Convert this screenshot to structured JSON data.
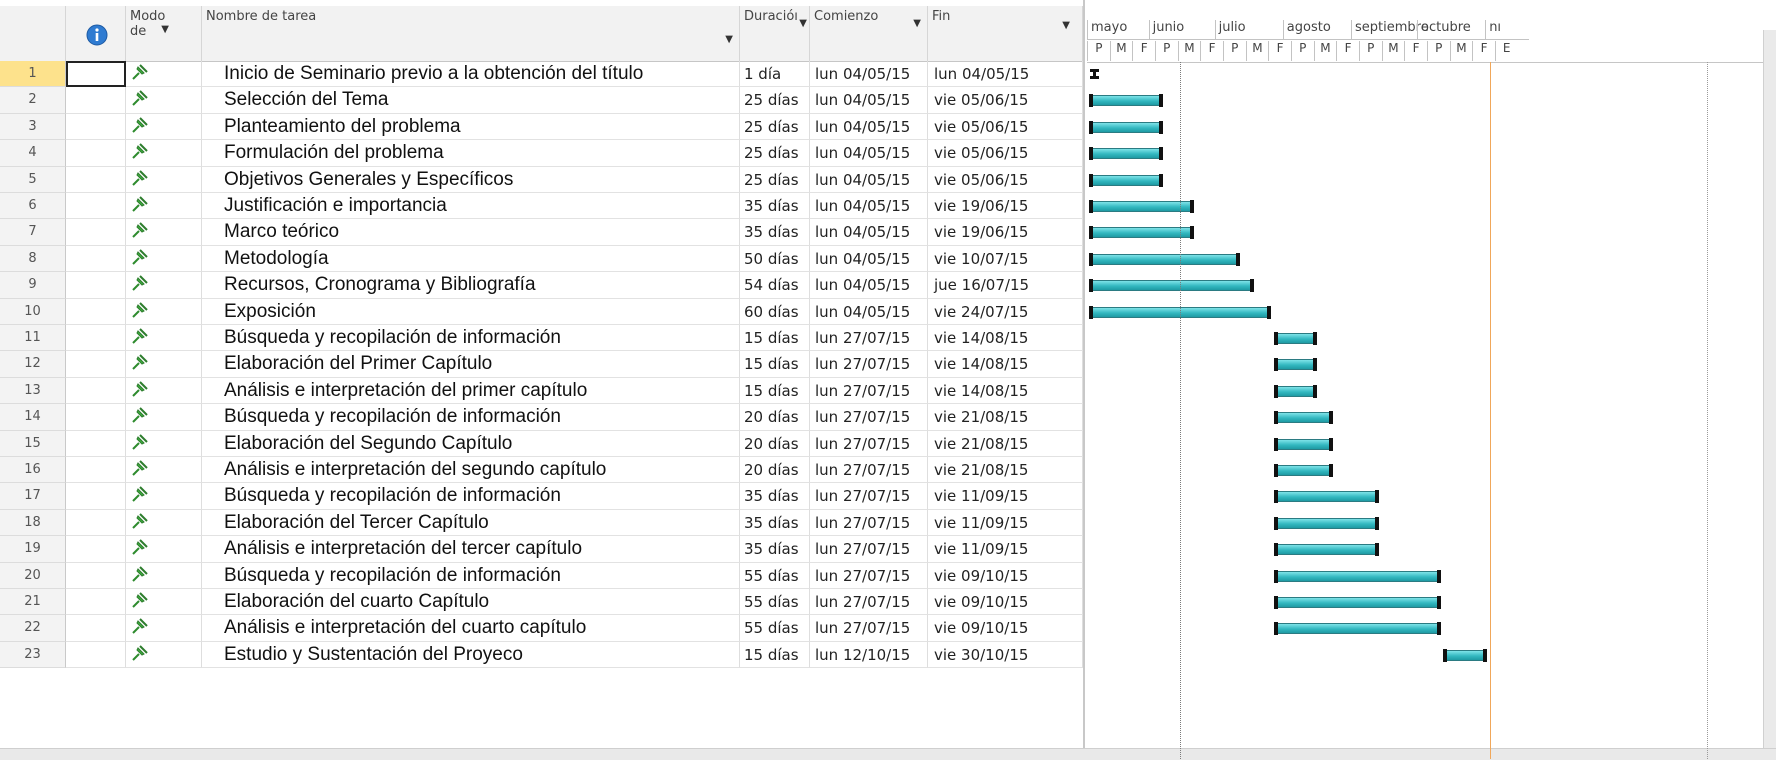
{
  "columns": {
    "indicators_icon": "info-icon",
    "mode_label": "Modo de",
    "name_label": "Nombre de tarea",
    "duration_label": "Duracióı",
    "start_label": "Comienzo",
    "finish_label": "Fin"
  },
  "timescale": {
    "months": [
      "mayo",
      "junio",
      "julio",
      "agosto",
      "septiembre",
      "octubre",
      "nı"
    ],
    "ticks": [
      "P",
      "M",
      "F",
      "P",
      "M",
      "F",
      "P",
      "M",
      "F",
      "P",
      "M",
      "F",
      "P",
      "M",
      "F",
      "P",
      "M",
      "F",
      "E"
    ]
  },
  "colors": {
    "bar": "#33b8c0",
    "selected_row": "#fde28c",
    "status_date_line": "#f0a75a"
  },
  "tasks": [
    {
      "id": "1",
      "name": "Inicio de Seminario previo a la obtención del título",
      "duration": "1 día",
      "start": "lun 04/05/15",
      "finish": "lun 04/05/15",
      "milestone": true,
      "s": 0,
      "e": 0
    },
    {
      "id": "2",
      "name": "Selección del Tema",
      "duration": "25 días",
      "start": "lun 04/05/15",
      "finish": "vie 05/06/15",
      "s": 0,
      "e": 32
    },
    {
      "id": "3",
      "name": "Planteamiento del problema",
      "duration": "25 días",
      "start": "lun 04/05/15",
      "finish": "vie 05/06/15",
      "s": 0,
      "e": 32
    },
    {
      "id": "4",
      "name": "Formulación del problema",
      "duration": "25 días",
      "start": "lun 04/05/15",
      "finish": "vie 05/06/15",
      "s": 0,
      "e": 32
    },
    {
      "id": "5",
      "name": "Objetivos Generales y Específicos",
      "duration": "25 días",
      "start": "lun 04/05/15",
      "finish": "vie 05/06/15",
      "s": 0,
      "e": 32
    },
    {
      "id": "6",
      "name": "Justificación e importancia",
      "duration": "35 días",
      "start": "lun 04/05/15",
      "finish": "vie 19/06/15",
      "s": 0,
      "e": 46
    },
    {
      "id": "7",
      "name": "Marco teórico",
      "duration": "35 días",
      "start": "lun 04/05/15",
      "finish": "vie 19/06/15",
      "s": 0,
      "e": 46
    },
    {
      "id": "8",
      "name": "Metodología",
      "duration": "50 días",
      "start": "lun 04/05/15",
      "finish": "vie 10/07/15",
      "s": 0,
      "e": 67
    },
    {
      "id": "9",
      "name": "Recursos, Cronograma y Bibliografía",
      "duration": "54 días",
      "start": "lun 04/05/15",
      "finish": "jue 16/07/15",
      "s": 0,
      "e": 73
    },
    {
      "id": "10",
      "name": "Exposición",
      "duration": "60 días",
      "start": "lun 04/05/15",
      "finish": "vie 24/07/15",
      "s": 0,
      "e": 81
    },
    {
      "id": "11",
      "name": "Búsqueda y recopilación de información",
      "duration": "15 días",
      "start": "lun 27/07/15",
      "finish": "vie 14/08/15",
      "s": 84,
      "e": 102
    },
    {
      "id": "12",
      "name": "Elaboración del Primer Capítulo",
      "duration": "15 días",
      "start": "lun 27/07/15",
      "finish": "vie 14/08/15",
      "s": 84,
      "e": 102
    },
    {
      "id": "13",
      "name": "Análisis e interpretación del primer capítulo",
      "duration": "15 días",
      "start": "lun 27/07/15",
      "finish": "vie 14/08/15",
      "s": 84,
      "e": 102
    },
    {
      "id": "14",
      "name": "Búsqueda y recopilación de información",
      "duration": "20 días",
      "start": "lun 27/07/15",
      "finish": "vie 21/08/15",
      "s": 84,
      "e": 109
    },
    {
      "id": "15",
      "name": "Elaboración del Segundo Capítulo",
      "duration": "20 días",
      "start": "lun 27/07/15",
      "finish": "vie 21/08/15",
      "s": 84,
      "e": 109
    },
    {
      "id": "16",
      "name": "Análisis e interpretación del segundo capítulo",
      "duration": "20 días",
      "start": "lun 27/07/15",
      "finish": "vie 21/08/15",
      "s": 84,
      "e": 109
    },
    {
      "id": "17",
      "name": "Búsqueda y recopilación de información",
      "duration": "35 días",
      "start": "lun 27/07/15",
      "finish": "vie 11/09/15",
      "s": 84,
      "e": 130
    },
    {
      "id": "18",
      "name": "Elaboración del Tercer Capítulo",
      "duration": "35 días",
      "start": "lun 27/07/15",
      "finish": "vie 11/09/15",
      "s": 84,
      "e": 130
    },
    {
      "id": "19",
      "name": "Análisis e interpretación del tercer capítulo",
      "duration": "35 días",
      "start": "lun 27/07/15",
      "finish": "vie 11/09/15",
      "s": 84,
      "e": 130
    },
    {
      "id": "20",
      "name": "Búsqueda y recopilación de información",
      "duration": "55 días",
      "start": "lun 27/07/15",
      "finish": "vie 09/10/15",
      "s": 84,
      "e": 158
    },
    {
      "id": "21",
      "name": "Elaboración del cuarto Capítulo",
      "duration": "55 días",
      "start": "lun 27/07/15",
      "finish": "vie 09/10/15",
      "s": 84,
      "e": 158
    },
    {
      "id": "22",
      "name": "Análisis e interpretación del cuarto capítulo",
      "duration": "55 días",
      "start": "lun 27/07/15",
      "finish": "vie 09/10/15",
      "s": 84,
      "e": 158
    },
    {
      "id": "23",
      "name": "Estudio y Sustentación del Proyeco",
      "duration": "15 días",
      "start": "lun 12/10/15",
      "finish": "vie 30/10/15",
      "s": 161,
      "e": 179
    }
  ]
}
